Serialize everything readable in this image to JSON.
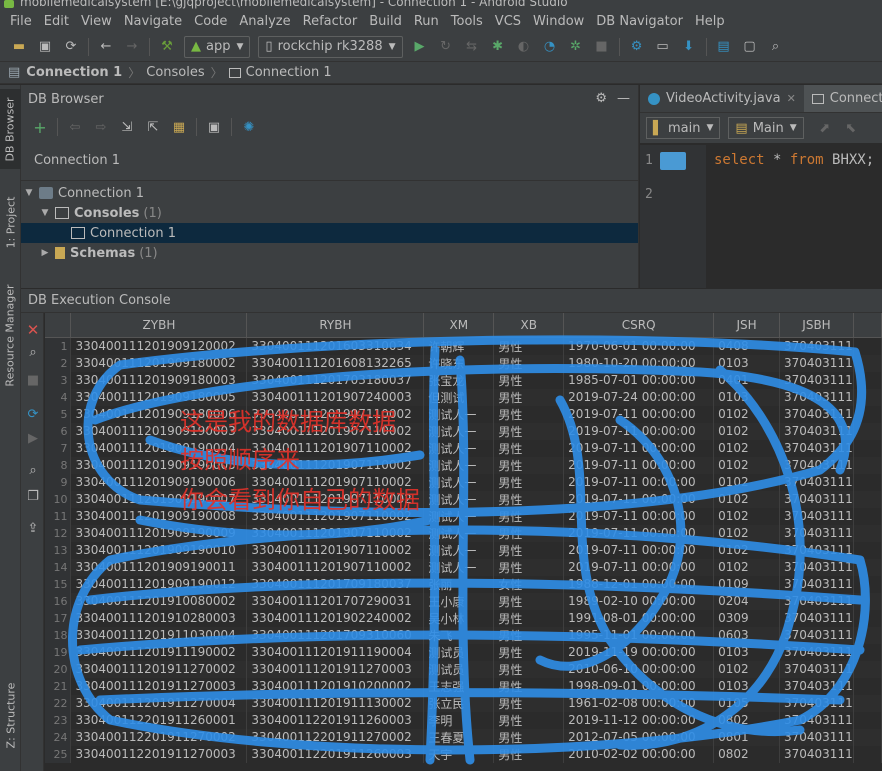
{
  "window": {
    "title": "mobilemedicalsystem [E:\\gjqproject\\mobilemedicalsystem] - Connection 1 - Android Studio"
  },
  "menu": [
    "File",
    "Edit",
    "View",
    "Navigate",
    "Code",
    "Analyze",
    "Refactor",
    "Build",
    "Run",
    "Tools",
    "VCS",
    "Window",
    "DB Navigator",
    "Help"
  ],
  "toolbar": {
    "module": "app",
    "device": "rockchip rk3288"
  },
  "breadcrumb": [
    "Connection 1",
    "Consoles",
    "Connection 1"
  ],
  "left_strip": {
    "db_browser": "DB Browser",
    "project": "1: Project",
    "resource_manager": "Resource Manager",
    "structure": "Z: Structure"
  },
  "db_browser": {
    "title": "DB Browser",
    "connection_label": "Connection 1",
    "tree": [
      {
        "label": "Connection 1",
        "count": ""
      },
      {
        "label": "Consoles",
        "count": "(1)"
      },
      {
        "label": "Connection 1",
        "count": ""
      },
      {
        "label": "Schemas",
        "count": "(1)"
      }
    ]
  },
  "editor": {
    "tabs": [
      "VideoActivity.java",
      "Connection"
    ],
    "branch": "main",
    "schema": "Main",
    "line_numbers": [
      "1",
      "2"
    ],
    "code": {
      "kw1": "select",
      "star": " * ",
      "kw2": "from",
      "table": " BHXX;"
    }
  },
  "console": {
    "title": "DB Execution Console",
    "columns": [
      "ZYBH",
      "RYBH",
      "XM",
      "XB",
      "CSRQ",
      "JSH",
      "JSBH"
    ],
    "rows": [
      [
        "1",
        "330400111201909120002",
        "330400111201603310034",
        "许朝辉",
        "男性",
        "1970-06-01 00:00:00",
        "0408",
        "370403111"
      ],
      [
        "2",
        "330400111201909180002",
        "330400111201608132265",
        "许晓东",
        "男性",
        "1980-10-20 00:00:00",
        "0103",
        "370403111"
      ],
      [
        "3",
        "330400111201909180003",
        "330400111201703180037",
        "张宝龙",
        "男性",
        "1985-07-01 00:00:00",
        "0401",
        "370403111"
      ],
      [
        "4",
        "330400111201909180005",
        "330400111201907240003",
        "但测试",
        "男性",
        "2019-07-24 00:00:00",
        "0103",
        "370403111"
      ],
      [
        "5",
        "330400111201909180006",
        "330400111201907110002",
        "测试人一",
        "男性",
        "2019-07-11 00:00:00",
        "0102",
        "370403111"
      ],
      [
        "6",
        "330400111201909190003",
        "330400111201907110002",
        "测试人一",
        "男性",
        "2019-07-11 00:00:00",
        "0102",
        "370403111"
      ],
      [
        "7",
        "330400111201909190004",
        "330400111201907110002",
        "测试人一",
        "男性",
        "2019-07-11 00:00:00",
        "0102",
        "370403111"
      ],
      [
        "8",
        "330400111201909190005",
        "330400111201907110002",
        "测试人一",
        "男性",
        "2019-07-11 00:00:00",
        "0102",
        "370403111"
      ],
      [
        "9",
        "330400111201909190006",
        "330400111201907110002",
        "测试人一",
        "男性",
        "2019-07-11 00:00:00",
        "0102",
        "370403111"
      ],
      [
        "10",
        "330400111201909190007",
        "330400111201907110002",
        "测试人一",
        "男性",
        "2019-07-11 00:00:00",
        "0102",
        "370403111"
      ],
      [
        "11",
        "330400111201909190008",
        "330400111201907110002",
        "测试人一",
        "男性",
        "2019-07-11 00:00:00",
        "0102",
        "370403111"
      ],
      [
        "12",
        "330400111201909190009",
        "330400111201907110002",
        "测试人一",
        "男性",
        "2019-07-11 00:00:00",
        "0102",
        "370403111"
      ],
      [
        "13",
        "330400111201909190010",
        "330400111201907110002",
        "测试人一",
        "男性",
        "2019-07-11 00:00:00",
        "0102",
        "370403111"
      ],
      [
        "14",
        "330400111201909190011",
        "330400111201907110002",
        "测试人一",
        "男性",
        "2019-07-11 00:00:00",
        "0102",
        "370403111"
      ],
      [
        "15",
        "330400111201909190012",
        "330400111201709180037",
        "张丽",
        "女性",
        "1988-12-01 00:00:00",
        "0109",
        "370403111"
      ],
      [
        "16",
        "330400111201910080002",
        "330400111201707290031",
        "王小康",
        "男性",
        "1989-02-10 00:00:00",
        "0204",
        "370403111"
      ],
      [
        "17",
        "330400111201910280003",
        "330400111201902240002",
        "吴小林",
        "男性",
        "1991-08-01 00:00:00",
        "0309",
        "370403111"
      ],
      [
        "18",
        "330400111201911030004",
        "330400111201709310060",
        "朱飞",
        "男性",
        "1995-11-01 00:00:00",
        "0603",
        "370403111"
      ],
      [
        "19",
        "330400111201911190002",
        "330400111201911190004",
        "测试员",
        "男性",
        "2019-11-19 00:00:00",
        "0103",
        "370403111"
      ],
      [
        "20",
        "330400111201911270002",
        "330400111201911270003",
        "测试员",
        "男性",
        "2010-06-10 00:00:00",
        "0102",
        "370403111"
      ],
      [
        "21",
        "330400111201911270003",
        "330400111201910200002",
        "王志强",
        "男性",
        "1998-09-01 00:00:00",
        "0103",
        "370403111"
      ],
      [
        "22",
        "330400111201911270004",
        "330400111201911130002",
        "张立民",
        "男性",
        "1961-02-08 00:00:00",
        "0105",
        "370403111"
      ],
      [
        "23",
        "330400112201911260001",
        "330400112201911260003",
        "李明",
        "男性",
        "2019-11-12 00:00:00",
        "0802",
        "370403111"
      ],
      [
        "24",
        "330400112201911270002",
        "330400112201911270002",
        "王春夏",
        "男性",
        "2012-07-05 00:00:00",
        "0801",
        "370403111"
      ],
      [
        "25",
        "330400112201911270003",
        "330400112201911260003",
        "天宇",
        "男性",
        "2010-02-02 00:00:00",
        "0802",
        "370403111"
      ]
    ]
  },
  "annotations": [
    "这是我的数据库数据",
    "按照顺序来",
    "你会看到你自己的数据"
  ]
}
